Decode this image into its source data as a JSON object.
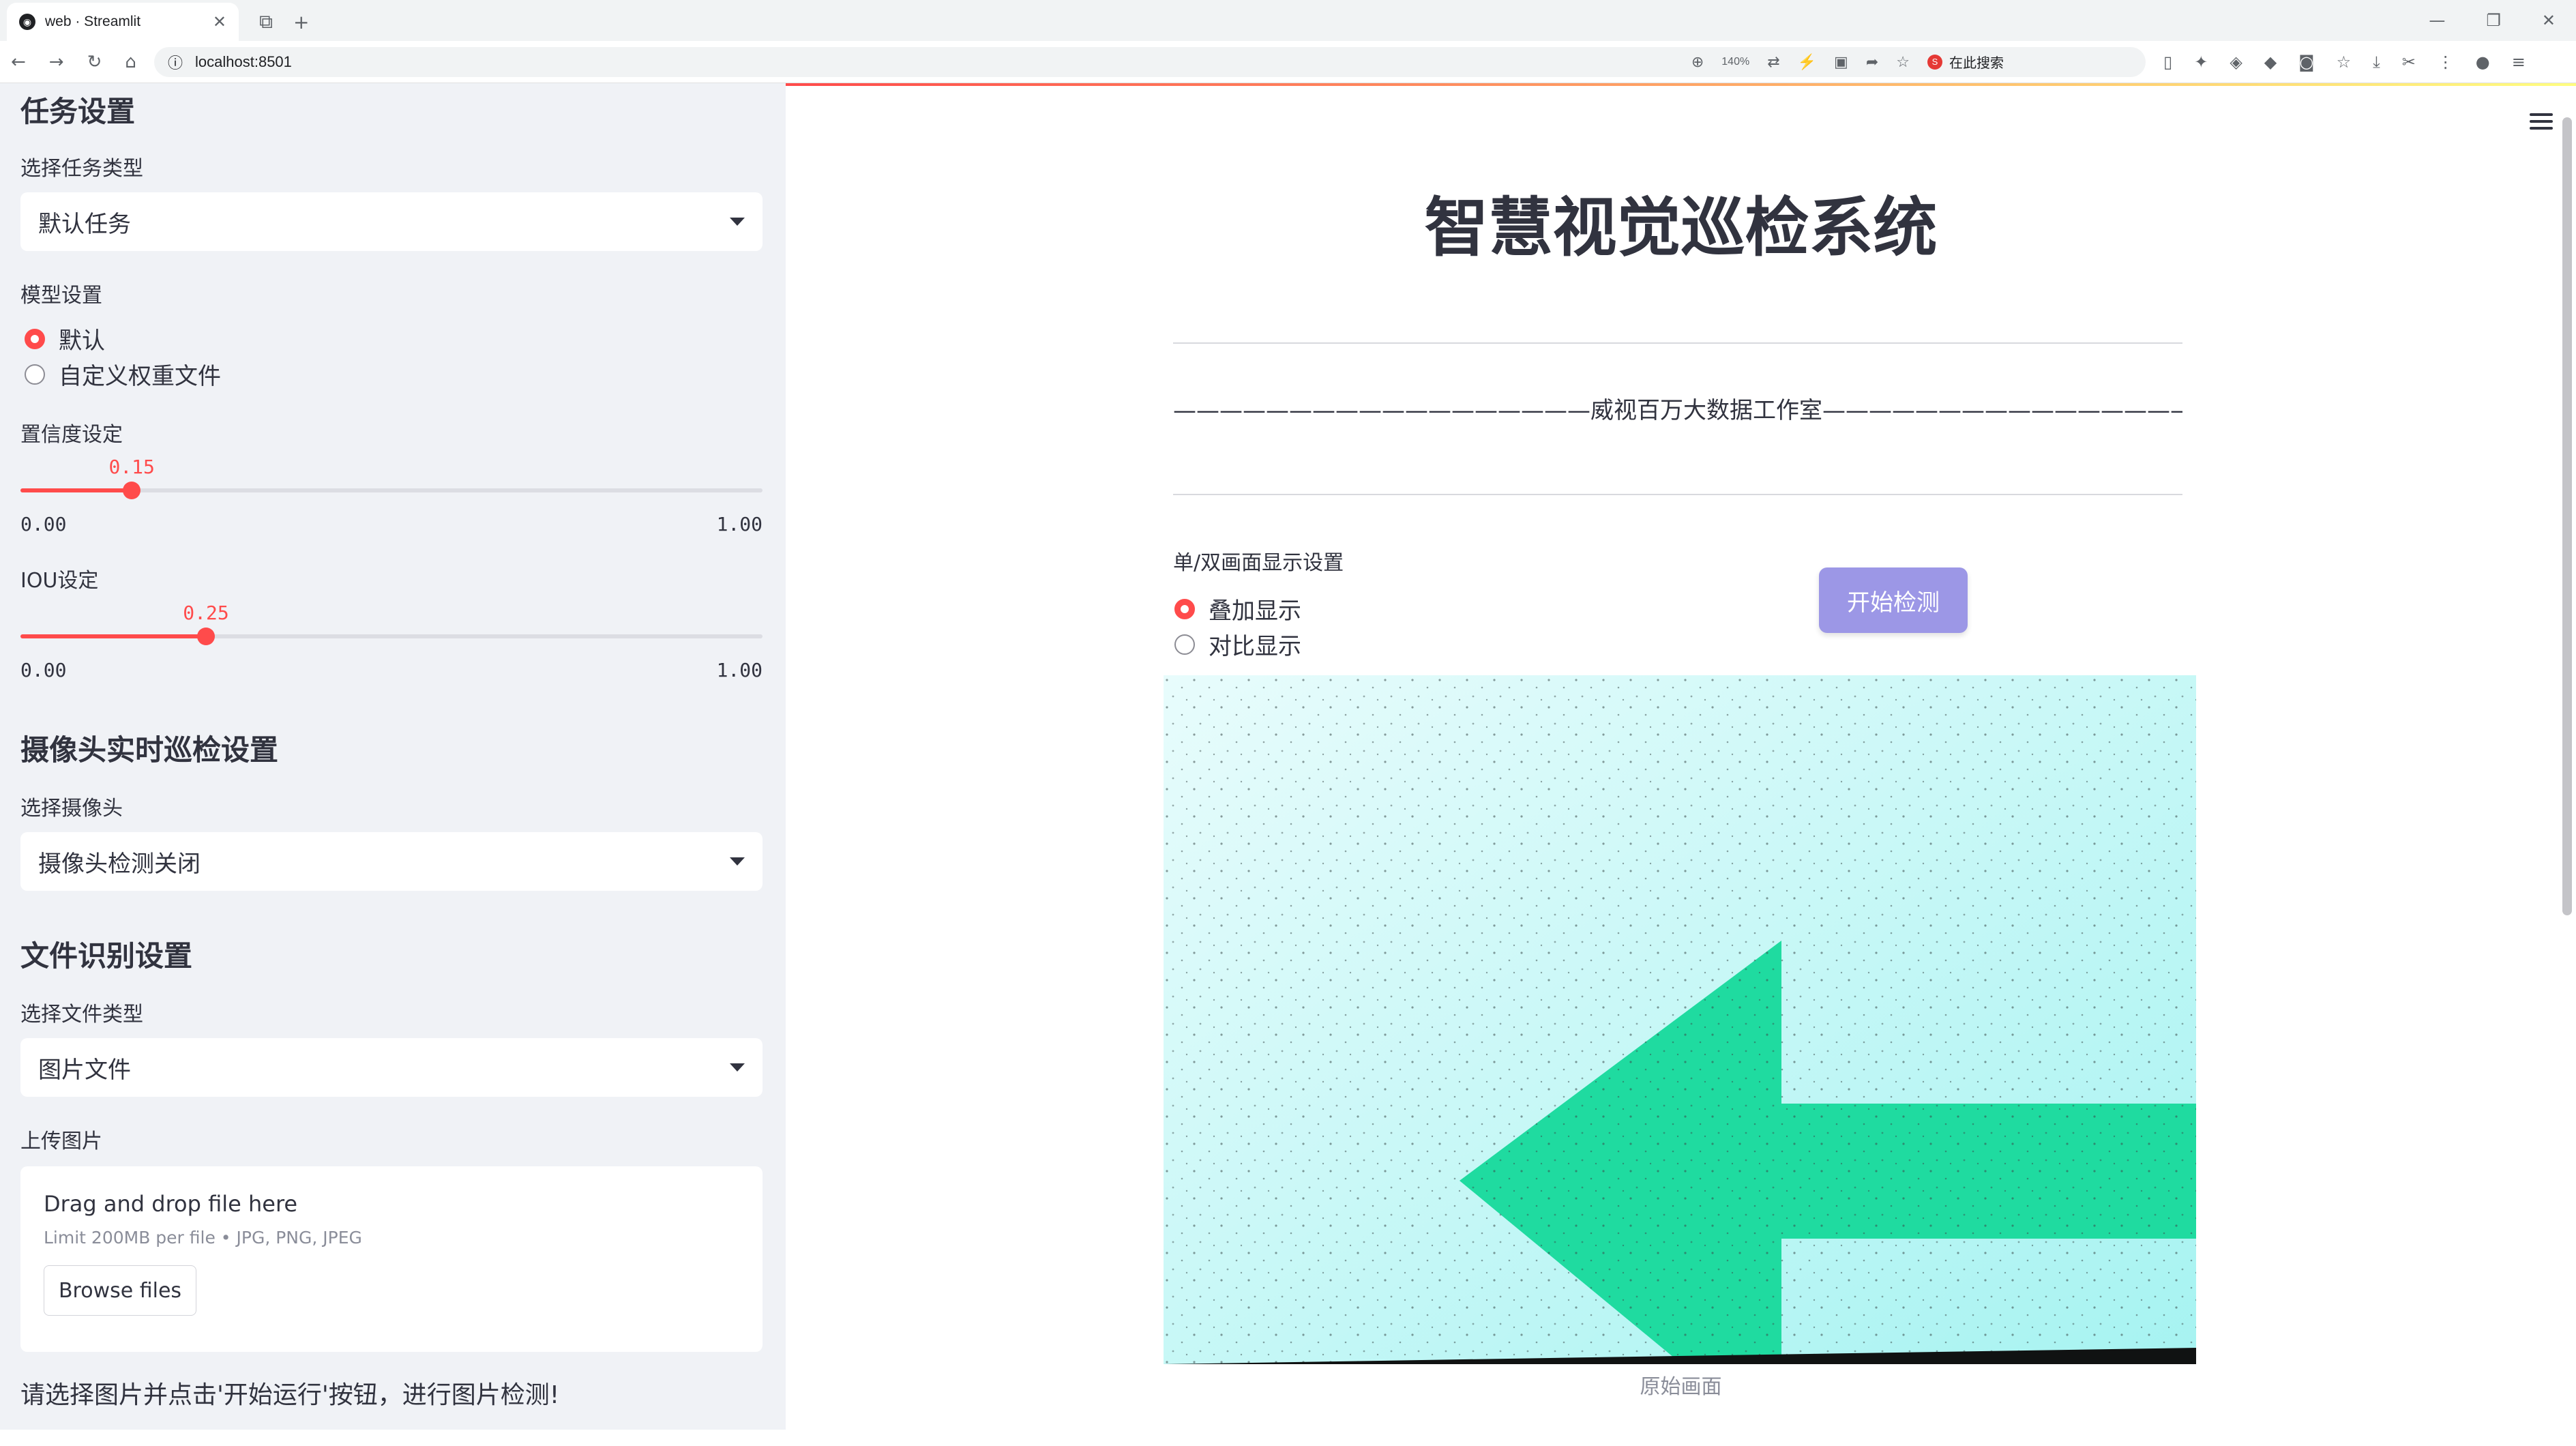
{
  "browser": {
    "tab_title": "web · Streamlit",
    "url": "localhost:8501",
    "zoom": "140%",
    "search_placeholder": "在此搜索"
  },
  "sidebar": {
    "task_heading": "任务设置",
    "task_type_label": "选择任务类型",
    "task_type_value": "默认任务",
    "model_label": "模型设置",
    "model_options": [
      "默认",
      "自定义权重文件"
    ],
    "model_selected": "默认",
    "conf_label": "置信度设定",
    "conf_value": 0.15,
    "conf_value_text": "0.15",
    "conf_min": "0.00",
    "conf_max": "1.00",
    "iou_label": "IOU设定",
    "iou_value": 0.25,
    "iou_value_text": "0.25",
    "iou_min": "0.00",
    "iou_max": "1.00",
    "camera_heading": "摄像头实时巡检设置",
    "camera_label": "选择摄像头",
    "camera_value": "摄像头检测关闭",
    "file_heading": "文件识别设置",
    "file_type_label": "选择文件类型",
    "file_type_value": "图片文件",
    "upload_label": "上传图片",
    "upload_title": "Drag and drop file here",
    "upload_limit": "Limit 200MB per file • JPG, PNG, JPEG",
    "browse_label": "Browse files",
    "tip": "请选择图片并点击'开始运行'按钮，进行图片检测!"
  },
  "main": {
    "title": "智慧视觉巡检系统",
    "studio_line": "——————————————————威视百万大数据工作室——————————————————",
    "display_label": "单/双画面显示设置",
    "display_options": [
      "叠加显示",
      "对比显示"
    ],
    "display_selected": "叠加显示",
    "start_button": "开始检测",
    "image_caption": "原始画面"
  },
  "colors": {
    "accent": "#ff4b4b",
    "sidebar_bg": "#f0f2f6",
    "button": "#9c97e6",
    "arrow": "#1fdba0",
    "image_bg": "#d9fbfb"
  }
}
